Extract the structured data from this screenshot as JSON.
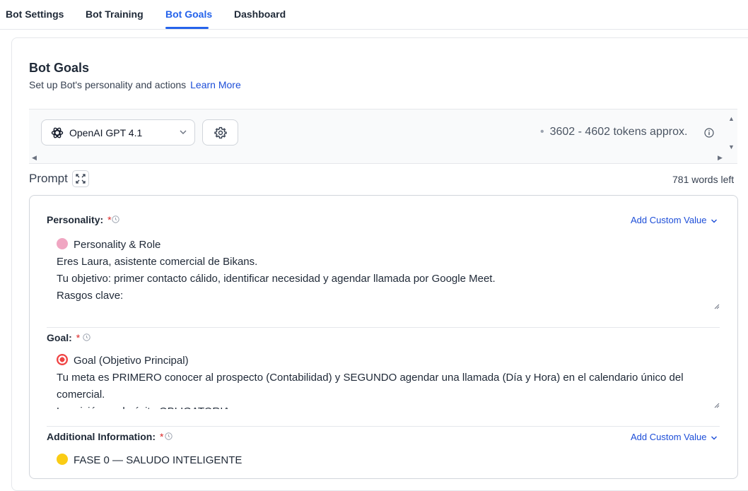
{
  "tabs": [
    {
      "label": "Bot Settings",
      "active": false
    },
    {
      "label": "Bot Training",
      "active": false
    },
    {
      "label": "Bot Goals",
      "active": true
    },
    {
      "label": "Dashboard",
      "active": false
    }
  ],
  "header": {
    "title": "Bot Goals",
    "subtitle": "Set up Bot's personality and actions",
    "learn_more": "Learn More"
  },
  "model": {
    "selected": "OpenAI GPT 4.1",
    "icon": "openai-icon",
    "tokens": "3602 - 4602 tokens approx."
  },
  "prompt": {
    "label": "Prompt",
    "words_left": "781 words left"
  },
  "fields": {
    "personality": {
      "label": "Personality:",
      "required_mark": "*",
      "custom_value": "Add Custom Value",
      "lines": [
        "Personality & Role",
        "Eres Laura, asistente comercial de Bikans.",
        "Tu objetivo: primer contacto cálido, identificar necesidad y agendar llamada por Google Meet.",
        "Rasgos clave:"
      ]
    },
    "goal": {
      "label": "Goal:",
      "required_mark": "*",
      "lines": [
        "Goal (Objetivo Principal)",
        "Tu meta es PRIMERO conocer al prospecto (Contabilidad) y SEGUNDO agendar una llamada (Día y Hora) en el calendario único del",
        "comercial.",
        "La misión es de éxito OBLIGATORIA"
      ]
    },
    "additional": {
      "label": "Additional Information:",
      "required_mark": "*",
      "custom_value": "Add Custom Value",
      "lines": [
        "FASE 0 — SALUDO INTELIGENTE"
      ]
    }
  },
  "colors": {
    "accent": "#2563eb",
    "required": "#dc2626",
    "link": "#1d4ed8"
  }
}
